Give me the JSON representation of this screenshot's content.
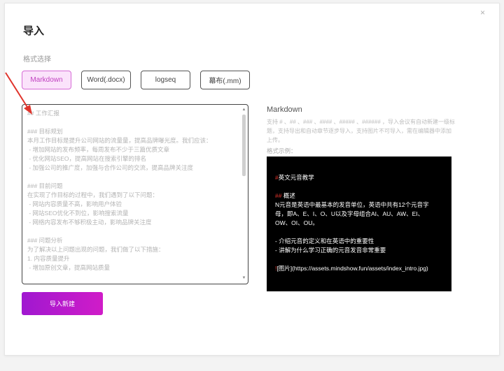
{
  "dialog": {
    "title": "导入",
    "close_icon": "×"
  },
  "format": {
    "label": "格式选择",
    "options": [
      {
        "label": "Markdown",
        "selected": true
      },
      {
        "label": "Word(.docx)",
        "selected": false
      },
      {
        "label": "logseq",
        "selected": false
      },
      {
        "label": "幕布(.mm)",
        "selected": false
      }
    ]
  },
  "editor": {
    "content": "## 工作汇报\n\n### 目标规划\n本月工作目标是提升公司网站的流量量，提高品牌曝光度。我们应该：\n - 增加网站的发布频率，每周发布不少于三篇优质文章\n - 优化网站SEO，提高网站在搜索引擎的排名\n - 加强公司的推广度，加强与合作公司的交流，提高品牌关注度\n\n### 目前问题\n在实现了作目标的过程中，我们遇到了以下问题：\n - 网站内容质量不高，影响用户体验\n - 网站SEO优化不到位，影响搜索流量\n - 网络内容发布不够积极主动，影响品牌关注度\n\n### 问题分析\n为了解决以上问题出现的问题，我们做了以下措施：\n1. 内容质量提升\n - 增加原创文章，提高网站质量"
  },
  "actions": {
    "import_label": "导入新建"
  },
  "preview": {
    "title": "Markdown",
    "description": "支持 # 、## 、### 、#### 、##### 、###### ，导入会议有自动新建一级标题，支持导出和自动章节逐步导入，支持图片不可导入，需在编辑器中添加上传。",
    "example_label": "格式示例：",
    "example_lines": [
      {
        "marker": "#",
        "text": "英文元音教学"
      },
      {
        "marker": "",
        "text": ""
      },
      {
        "marker": "##",
        "text": "概述"
      },
      {
        "marker": "",
        "text": " N元音是英语中最基本的发音单位，英语中共有12个元音字"
      },
      {
        "marker": "",
        "text": "母，即A、E、I、O、U以及字母组合AI、AU、AW、EI、"
      },
      {
        "marker": "",
        "text": "OW、OI、OU。"
      },
      {
        "marker": "",
        "text": ""
      },
      {
        "marker": "",
        "text": "- 介绍元音的定义和在英语中的重要性"
      },
      {
        "marker": "",
        "text": "- 讲解为什么学习正确的元音发音非常重要"
      },
      {
        "marker": "",
        "text": ""
      },
      {
        "marker": "!",
        "text": "[图片](https://assets.mindshow.fun/assets/index_intro.jpg)"
      }
    ]
  },
  "colors": {
    "accent": "#c040c0",
    "selected_bg": "#fbe3fb",
    "import_button_start": "#a018d0",
    "import_button_end": "#d01cc8",
    "arrow": "#e0342c"
  }
}
